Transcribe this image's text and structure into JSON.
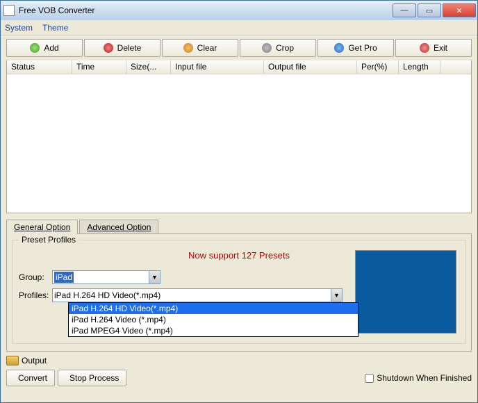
{
  "window": {
    "title": "Free VOB Converter"
  },
  "menu": {
    "system": "System",
    "theme": "Theme"
  },
  "toolbar": {
    "add": "Add",
    "delete": "Delete",
    "clear": "Clear",
    "crop": "Crop",
    "getpro": "Get Pro",
    "exit": "Exit"
  },
  "columns": {
    "status": "Status",
    "time": "Time",
    "size": "Size(...",
    "input": "Input file",
    "output": "Output file",
    "per": "Per(%)",
    "length": "Length"
  },
  "tabs": {
    "general": "General Option",
    "advanced": "Advanced Option"
  },
  "preset": {
    "legend": "Preset Profiles",
    "support": "Now support 127 Presets",
    "group_label": "Group:",
    "group_value": "iPad",
    "profiles_label": "Profiles:",
    "profiles_value": "iPad H.264 HD Video(*.mp4)",
    "options": {
      "o1": "iPad H.264 HD Video(*.mp4)",
      "o2": "iPad H.264 Video (*.mp4)",
      "o3": "iPad MPEG4 Video (*.mp4)"
    }
  },
  "output_label": "Output",
  "actions": {
    "convert": "Convert",
    "stop": "Stop Process",
    "shutdown": "Shutdown When Finished"
  }
}
